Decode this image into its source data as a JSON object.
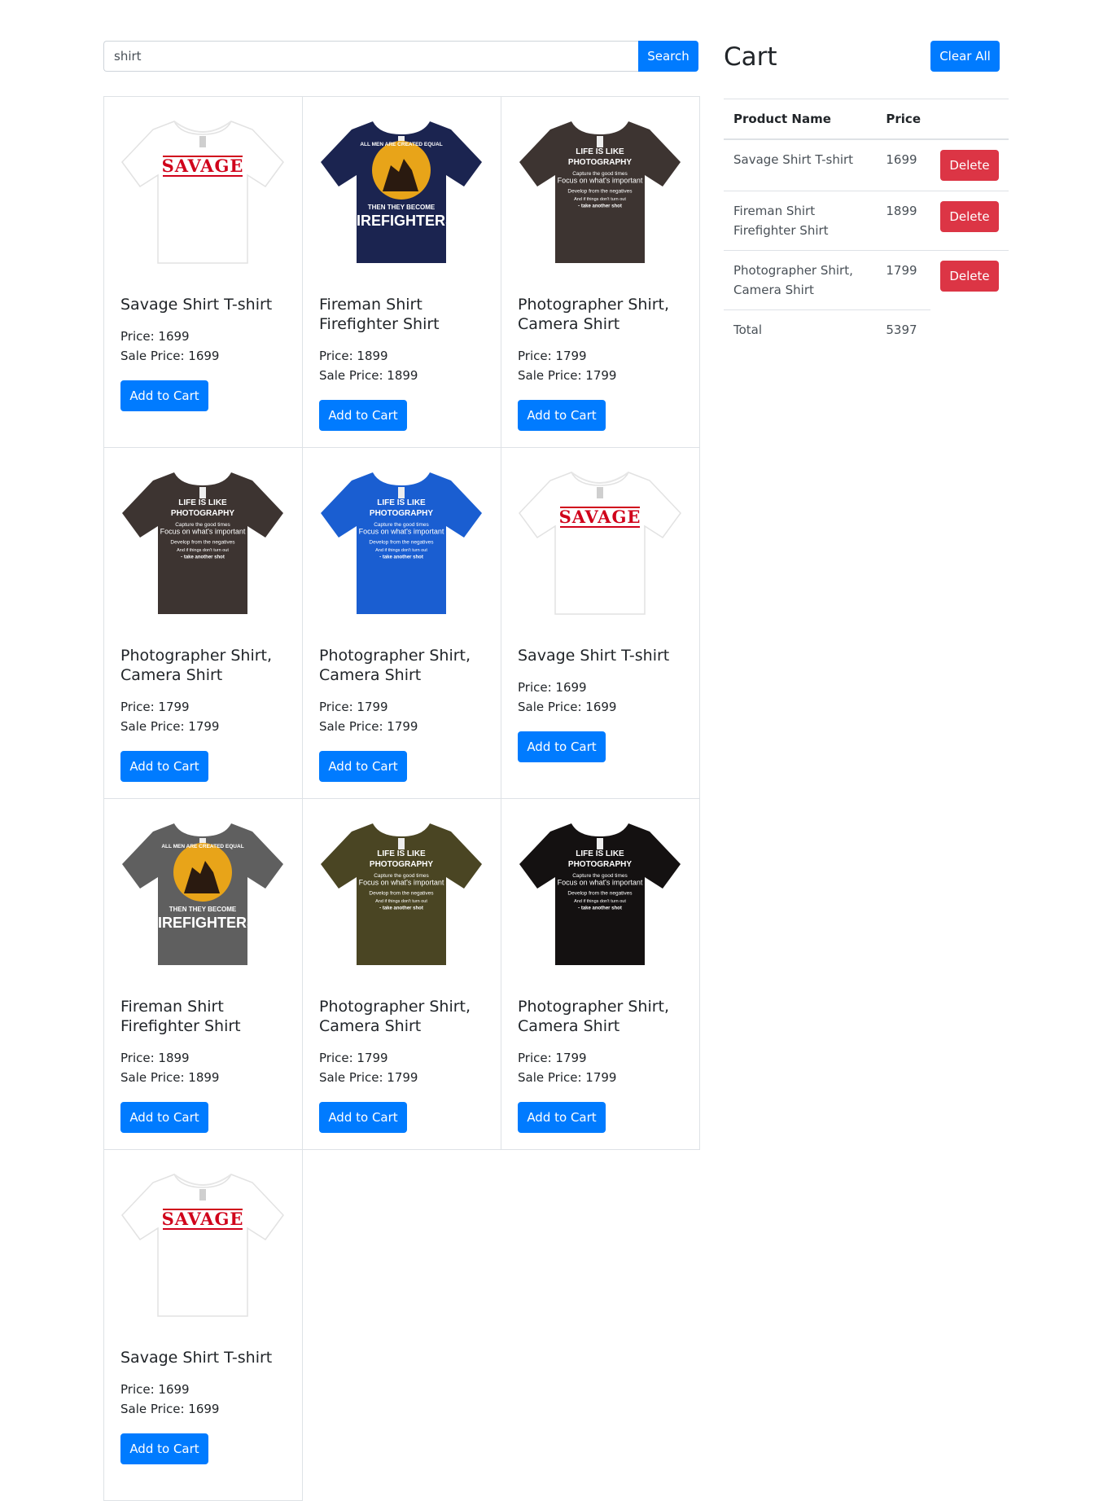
{
  "search": {
    "value": "shirt",
    "button_label": "Search"
  },
  "products": [
    {
      "name": "Savage Shirt T-shirt",
      "price": "Price: 1699",
      "sale_price": "Sale Price: 1699",
      "button": "Add to Cart",
      "image": "savage-tshirt-white",
      "shirt_color": "#ffffff"
    },
    {
      "name": "Fireman Shirt Firefighter Shirt",
      "price": "Price: 1899",
      "sale_price": "Sale Price: 1899",
      "button": "Add to Cart",
      "image": "firefighter-tshirt-navy",
      "shirt_color": "#1b2450"
    },
    {
      "name": "Photographer Shirt, Camera Shirt",
      "price": "Price: 1799",
      "sale_price": "Sale Price: 1799",
      "button": "Add to Cart",
      "image": "photography-tshirt-brown",
      "shirt_color": "#3d3431"
    },
    {
      "name": "Photographer Shirt, Camera Shirt",
      "price": "Price: 1799",
      "sale_price": "Sale Price: 1799",
      "button": "Add to Cart",
      "image": "photography-tshirt-brown",
      "shirt_color": "#3d3431"
    },
    {
      "name": "Photographer Shirt, Camera Shirt",
      "price": "Price: 1799",
      "sale_price": "Sale Price: 1799",
      "button": "Add to Cart",
      "image": "photography-tshirt-royal-blue",
      "shirt_color": "#1a5ed1"
    },
    {
      "name": "Savage Shirt T-shirt",
      "price": "Price: 1699",
      "sale_price": "Sale Price: 1699",
      "button": "Add to Cart",
      "image": "savage-tshirt-white",
      "shirt_color": "#ffffff"
    },
    {
      "name": "Fireman Shirt Firefighter Shirt",
      "price": "Price: 1899",
      "sale_price": "Sale Price: 1899",
      "button": "Add to Cart",
      "image": "firefighter-tshirt-grey",
      "shirt_color": "#5f5f5f"
    },
    {
      "name": "Photographer Shirt, Camera Shirt",
      "price": "Price: 1799",
      "sale_price": "Sale Price: 1799",
      "button": "Add to Cart",
      "image": "photography-tshirt-olive",
      "shirt_color": "#4a4523"
    },
    {
      "name": "Photographer Shirt, Camera Shirt",
      "price": "Price: 1799",
      "sale_price": "Sale Price: 1799",
      "button": "Add to Cart",
      "image": "photography-tshirt-black",
      "shirt_color": "#141111"
    },
    {
      "name": "Savage Shirt T-shirt",
      "price": "Price: 1699",
      "sale_price": "Sale Price: 1699",
      "button": "Add to Cart",
      "image": "savage-tshirt-white",
      "shirt_color": "#ffffff"
    }
  ],
  "print_text": {
    "savage": "SAVAGE",
    "firefighter_top": "ALL MEN ARE CREATED EQUAL",
    "firefighter_mid": "THEN THEY BECOME",
    "firefighter_big": "FIREFIGHTERS",
    "photo_lines": [
      "LIFE IS LIKE",
      "PHOTOGRAPHY",
      "Capture the good times",
      "Focus on what's important",
      "Develop from the negatives",
      "And if things don't turn out",
      "- take another shot"
    ]
  },
  "cart": {
    "title": "Cart",
    "clear_label": "Clear All",
    "headers": {
      "name": "Product Name",
      "price": "Price"
    },
    "items": [
      {
        "name": "Savage Shirt T-shirt",
        "price": "1699",
        "delete_label": "Delete"
      },
      {
        "name": "Fireman Shirt Firefighter Shirt",
        "price": "1899",
        "delete_label": "Delete"
      },
      {
        "name": "Photographer Shirt, Camera Shirt",
        "price": "1799",
        "delete_label": "Delete"
      }
    ],
    "total_label": "Total",
    "total_value": "5397"
  },
  "colors": {
    "primary": "#007bff",
    "danger": "#dc3545",
    "border": "#dee2e6",
    "savage_red": "#d0021b"
  }
}
